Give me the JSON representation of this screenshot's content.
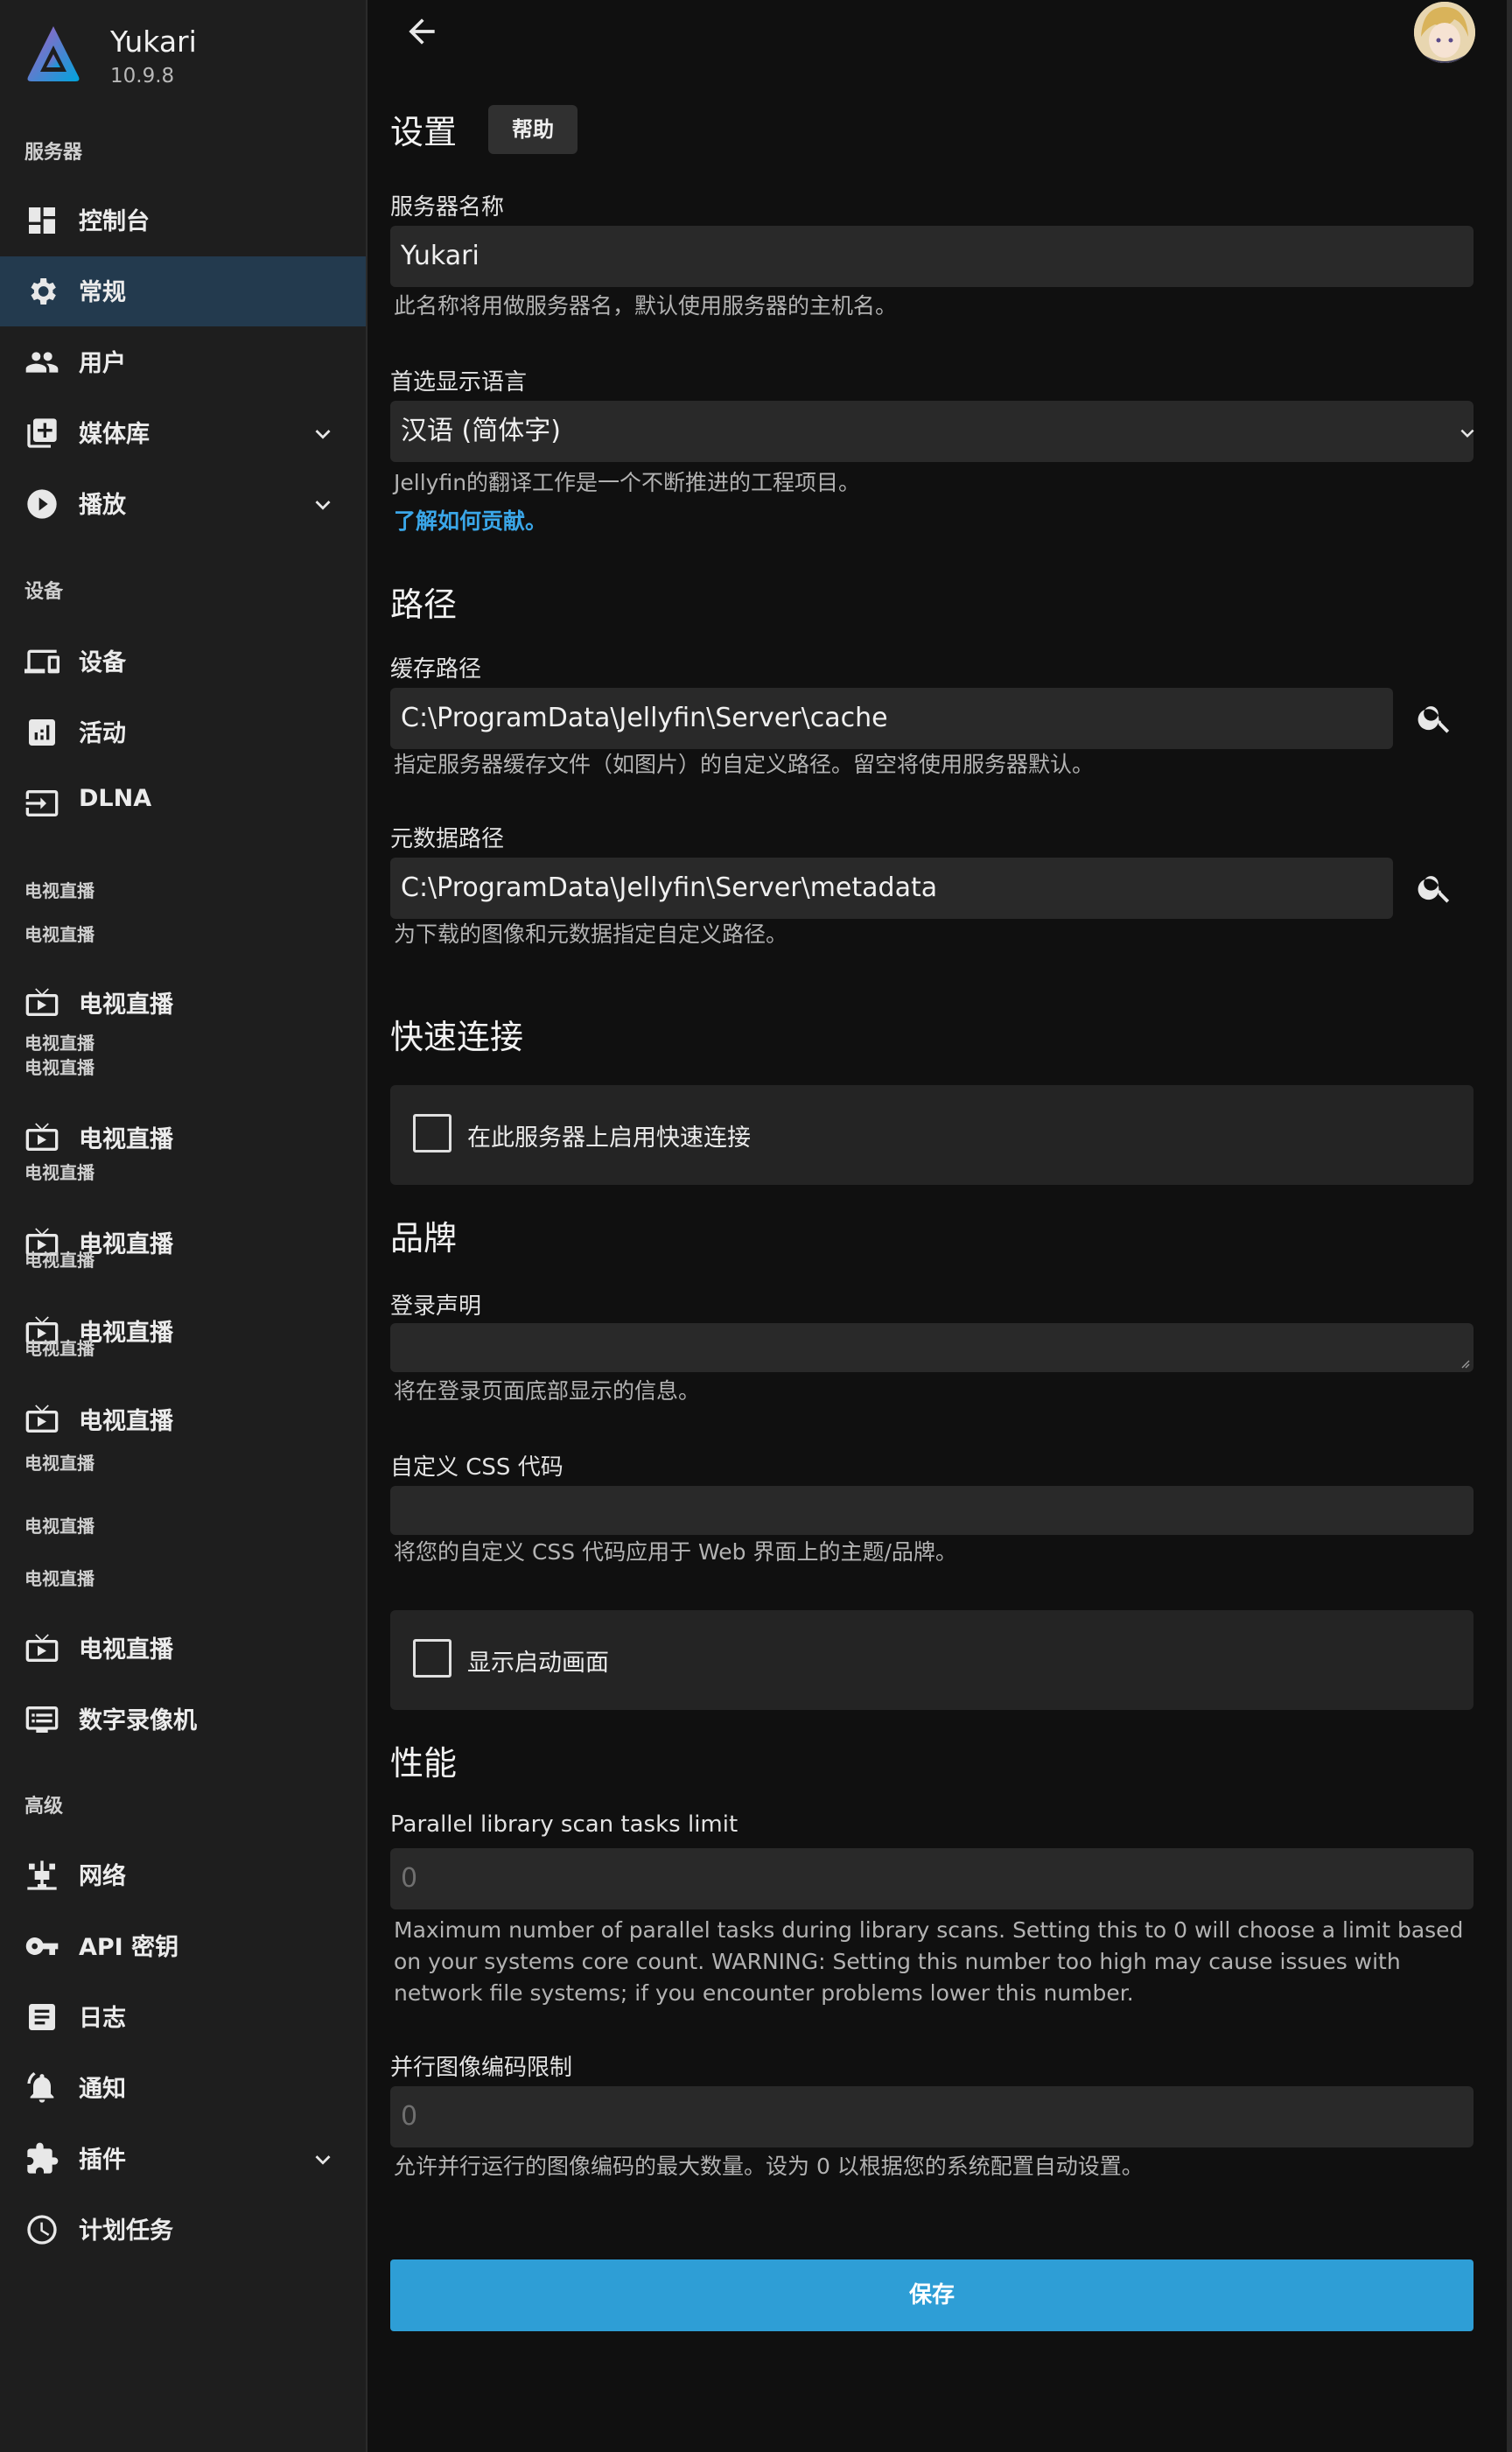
{
  "brand": {
    "name": "Yukari",
    "version": "10.9.8"
  },
  "sidebar": {
    "section_server": "服务器",
    "dashboard": "控制台",
    "general": "常规",
    "users": "用户",
    "libraries": "媒体库",
    "playback": "播放",
    "section_devices": "设备",
    "devices": "设备",
    "activity": "活动",
    "dlna": "DLNA",
    "section_livetv": "电视直播",
    "livetv_sub_a": "电视直播",
    "livetv_1": "电视直播",
    "livetv_1_sub_a": "电视直播",
    "livetv_1_sub_b": "电视直播",
    "livetv_2": "电视直播",
    "livetv_2_sub": "电视直播",
    "livetv_3": "电视直播",
    "livetv_3_sub": "电视直播",
    "livetv_4": "电视直播",
    "livetv_4_sub": "电视直播",
    "livetv_5": "电视直播",
    "livetv_5_sub": "电视直播",
    "livetv_h1": "电视直播",
    "livetv_h2": "电视直播",
    "livetv_6": "电视直播",
    "dvr": "数字录像机",
    "section_advanced": "高级",
    "network": "网络",
    "api_keys": "API 密钥",
    "logs": "日志",
    "notifications": "通知",
    "plugins": "插件",
    "scheduled_tasks": "计划任务"
  },
  "main": {
    "settings_title": "设置",
    "help_label": "帮助",
    "server_name_label": "服务器名称",
    "server_name_value": "Yukari",
    "server_name_help": "此名称将用做服务器名，默认使用服务器的主机名。",
    "language_label": "首选显示语言",
    "language_value": "汉语 (简体字)",
    "language_help": "Jellyfin的翻译工作是一个不断推进的工程项目。",
    "language_link": "了解如何贡献。",
    "paths_title": "路径",
    "cache_label": "缓存路径",
    "cache_value": "C:\\ProgramData\\Jellyfin\\Server\\cache",
    "cache_help": "指定服务器缓存文件（如图片）的自定义路径。留空将使用服务器默认。",
    "metadata_label": "元数据路径",
    "metadata_value": "C:\\ProgramData\\Jellyfin\\Server\\metadata",
    "metadata_help": "为下载的图像和元数据指定自定义路径。",
    "quick_connect_title": "快速连接",
    "quick_connect_checkbox": "在此服务器上启用快速连接",
    "branding_title": "品牌",
    "login_disclaimer_label": "登录声明",
    "login_disclaimer_help": "将在登录页面底部显示的信息。",
    "custom_css_label": "自定义 CSS 代码",
    "custom_css_help": "将您的自定义 CSS 代码应用于 Web 界面上的主题/品牌。",
    "splash_checkbox": "显示启动画面",
    "performance_title": "性能",
    "parallel_scan_label": "Parallel library scan tasks limit",
    "parallel_scan_placeholder": "0",
    "parallel_scan_help": "Maximum number of parallel tasks during library scans. Setting this to 0 will choose a limit based on your systems core count. WARNING: Setting this number too high may cause issues with network file systems; if you encounter problems lower this number.",
    "image_encode_label": "并行图像编码限制",
    "image_encode_placeholder": "0",
    "image_encode_help": "允许并行运行的图像编码的最大数量。设为 0 以根据您的系统配置自动设置。",
    "save_label": "保存"
  },
  "colors": {
    "accent": "#2e9ed6",
    "link": "#3aa6e8",
    "active_nav": "#233a4e"
  }
}
